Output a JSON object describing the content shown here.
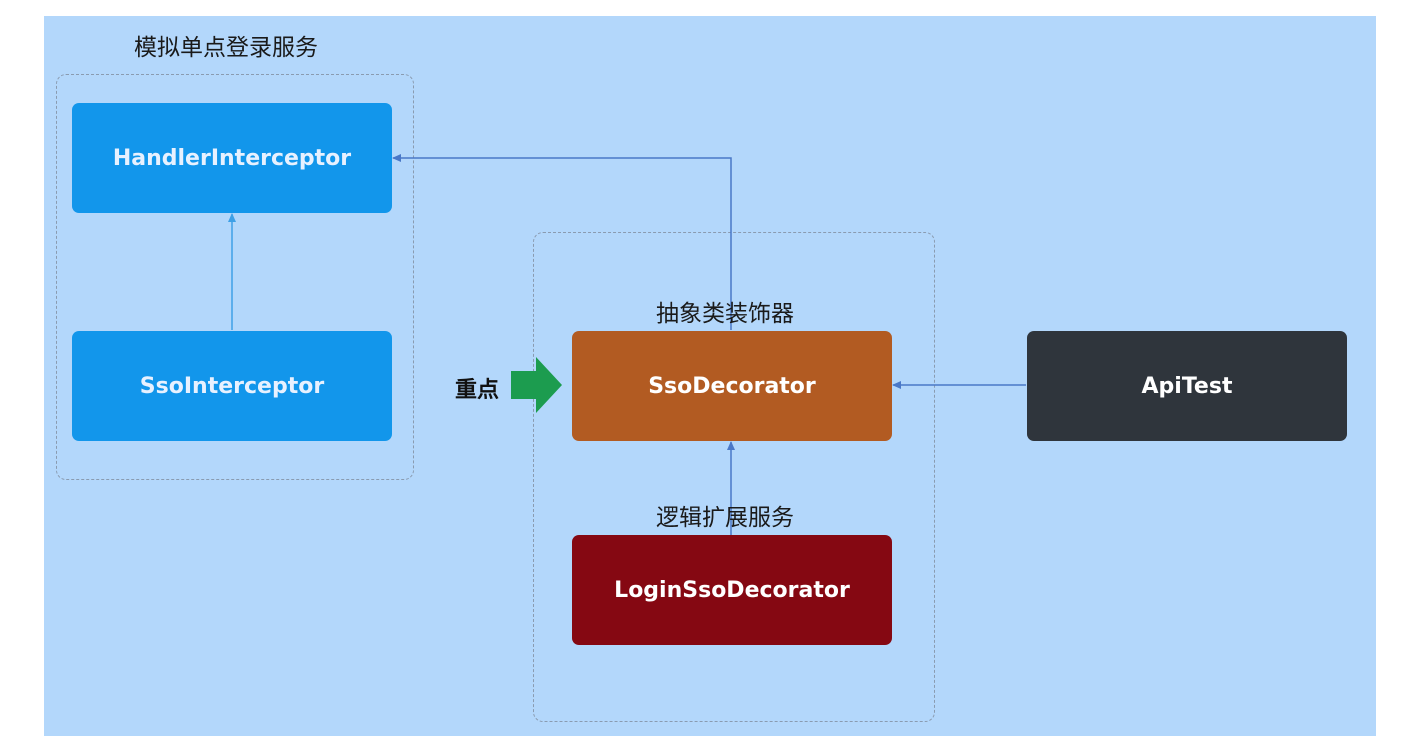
{
  "groups": {
    "sso_service_label": "模拟单点登录服务"
  },
  "labels": {
    "abstract_decorator": "抽象类装饰器",
    "logic_extension": "逻辑扩展服务",
    "focus": "重点"
  },
  "nodes": {
    "handler_interceptor": "HandlerInterceptor",
    "sso_interceptor": "SsoInterceptor",
    "sso_decorator": "SsoDecorator",
    "login_sso_decorator": "LoginSsoDecorator",
    "api_test": "ApiTest"
  },
  "colors": {
    "background": "#b3d7fb",
    "blue_node": "#1296eb",
    "orange_node": "#b25b22",
    "dark_node": "#2f353c",
    "red_node": "#850812",
    "focus_arrow": "#1c9c4f",
    "connector": "#4a78c8"
  }
}
